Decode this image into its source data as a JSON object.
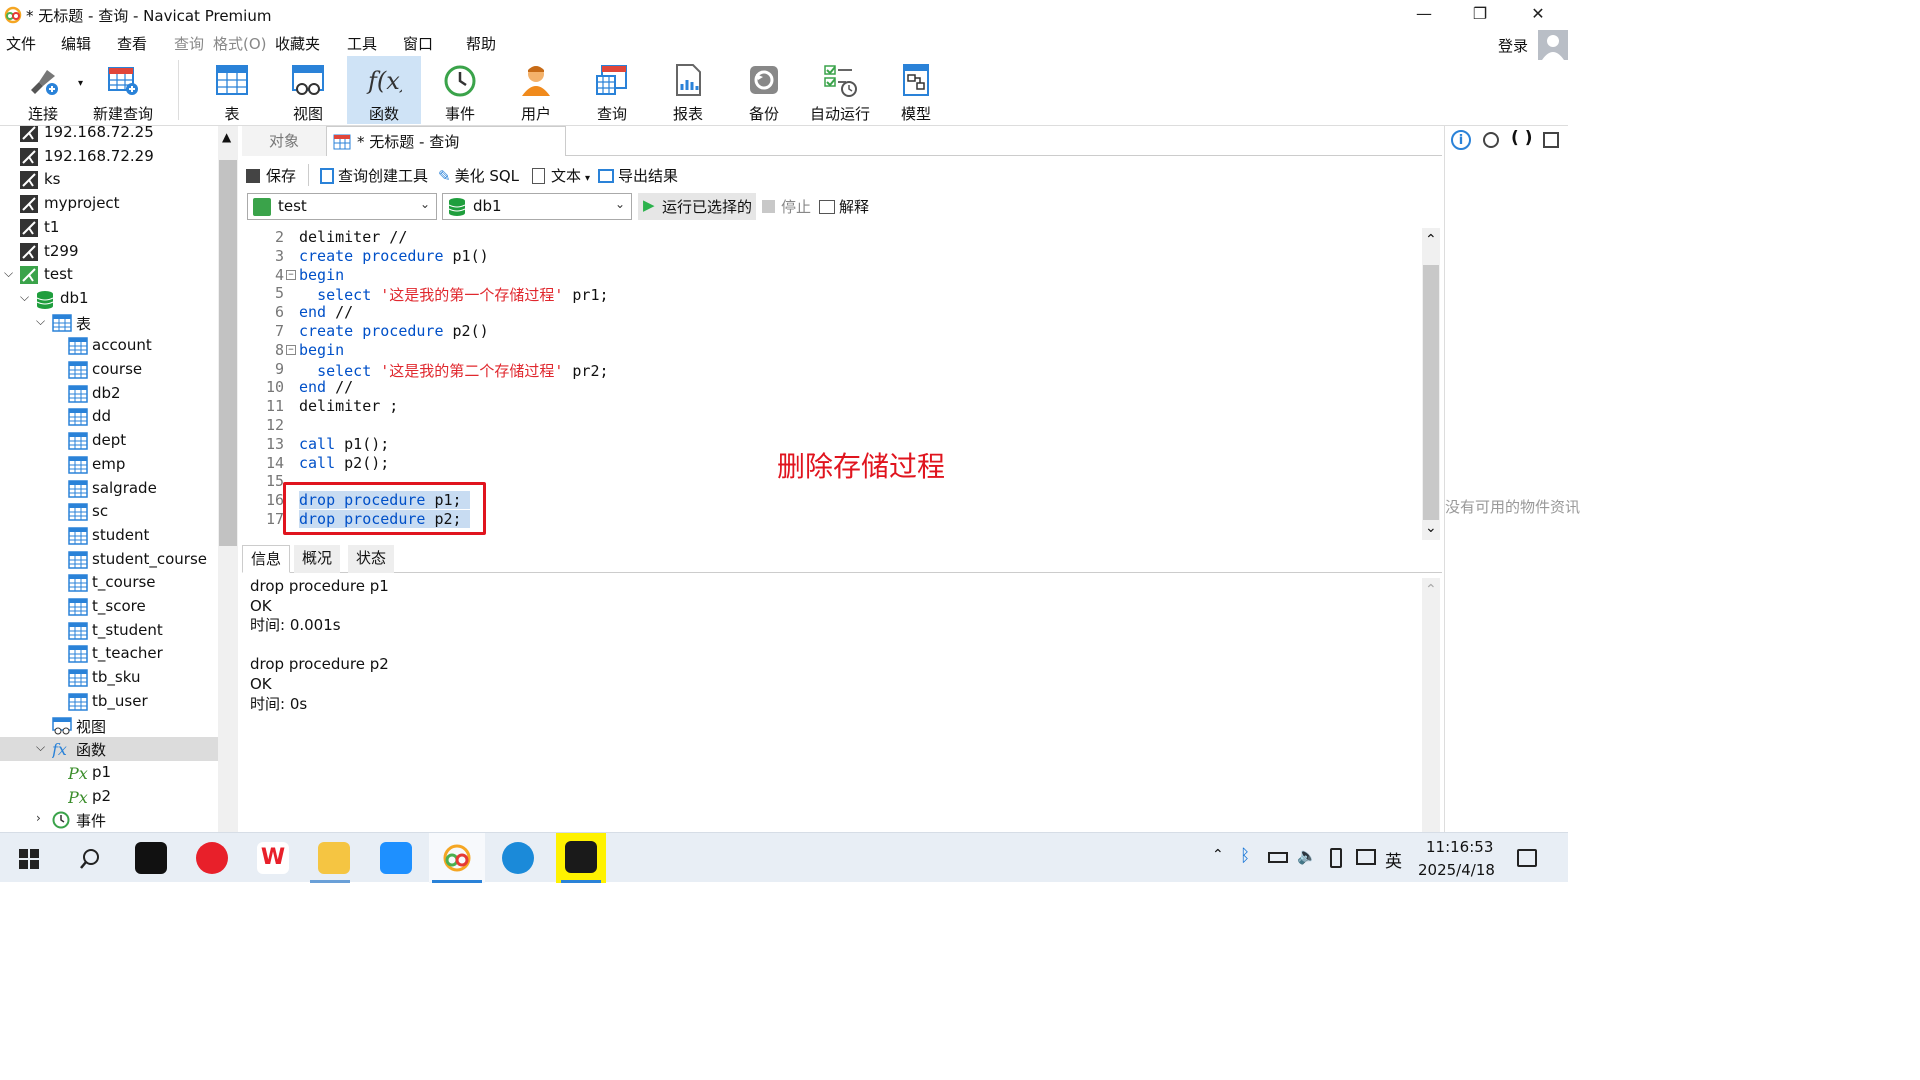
{
  "window": {
    "title": "* 无标题 - 查询 - Navicat Premium",
    "minimize": "—",
    "restore": "❐",
    "close": "✕"
  },
  "menu": [
    "文件",
    "编辑",
    "查看",
    "查询",
    "格式(O)",
    "收藏夹",
    "工具",
    "窗口",
    "帮助"
  ],
  "login": "登录",
  "toolbar": [
    "连接",
    "新建查询",
    "表",
    "视图",
    "函数",
    "事件",
    "用户",
    "查询",
    "报表",
    "备份",
    "自动运行",
    "模型"
  ],
  "toolbar_active": "函数",
  "sidebar": {
    "connections": [
      "192.168.72.25",
      "192.168.72.29",
      "ks",
      "myproject",
      "t1",
      "t299",
      "test"
    ],
    "database": "db1",
    "tables_group": "表",
    "tables": [
      "account",
      "course",
      "db2",
      "dd",
      "dept",
      "emp",
      "salgrade",
      "sc",
      "student",
      "student_course",
      "t_course",
      "t_score",
      "t_student",
      "t_teacher",
      "tb_sku",
      "tb_user"
    ],
    "views_group": "视图",
    "functions_group": "函数",
    "functions": [
      "p1",
      "p2"
    ],
    "events_group": "事件"
  },
  "tabs": {
    "objects": "对象",
    "query": "* 无标题 - 查询"
  },
  "query_toolbar": {
    "save": "保存",
    "builder": "查询创建工具",
    "beautify": "美化 SQL",
    "text": "文本",
    "export": "导出结果"
  },
  "selectors": {
    "connection": "test",
    "database": "db1",
    "run_selected": "运行已选择的",
    "stop": "停止",
    "explain": "解释"
  },
  "editor": {
    "line_numbers": [
      "2",
      "3",
      "4",
      "5",
      "6",
      "7",
      "8",
      "9",
      "10",
      "11",
      "12",
      "13",
      "14",
      "15",
      "16",
      "17"
    ],
    "lines": [
      "delimiter //",
      "create procedure p1()",
      "begin",
      "  select '这是我的第一个存储过程' pr1;",
      "end //",
      "create procedure p2()",
      "begin",
      "  select '这是我的第二个存储过程' pr2;",
      "end //",
      "delimiter ;",
      "",
      "call p1();",
      "call p2();",
      "",
      "drop procedure p1;",
      "drop procedure p2;"
    ],
    "annotation": "删除存储过程"
  },
  "result_tabs": [
    "信息",
    "概况",
    "状态"
  ],
  "result": {
    "lines": [
      "drop procedure p1",
      "OK",
      "时间: 0.001s",
      "",
      "drop procedure p2",
      "OK",
      "时间: 0s"
    ]
  },
  "right_panel": {
    "empty_text": "没有可用的物件资讯"
  },
  "taskbar": {
    "ime": "英",
    "time": "11:16:53",
    "date": "2025/4/18"
  }
}
